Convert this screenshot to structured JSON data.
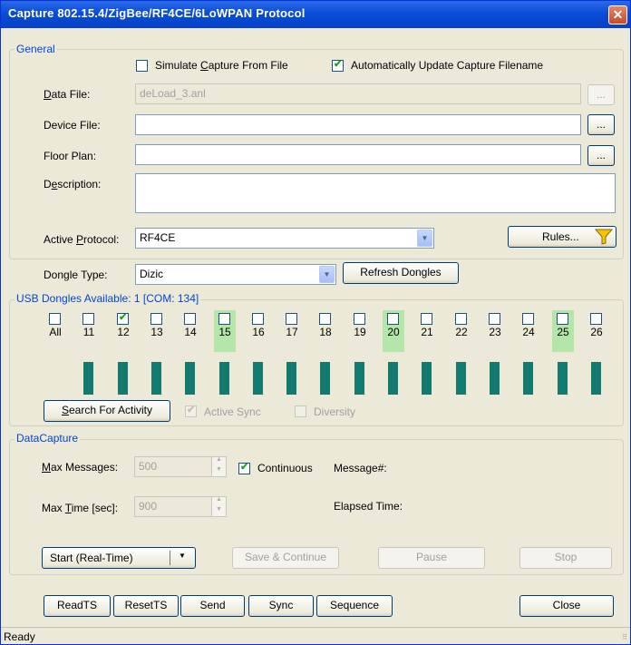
{
  "window": {
    "title": "Capture 802.15.4/ZigBee/RF4CE/6LoWPAN Protocol",
    "close_glyph": "✕"
  },
  "general": {
    "legend": "General",
    "simulate_label": "Simulate ",
    "simulate_u": "C",
    "simulate_rest": "apture From File",
    "simulate_checked": false,
    "auto_update_label": "Automatically Update Capture Filename",
    "auto_update_checked": true,
    "data_file_u": "D",
    "data_file_label": "ata File:",
    "data_file_value": "deLoad_3.anl",
    "device_file_label": "Device File:",
    "device_file_value": "",
    "floor_plan_label": "Floor Plan:",
    "floor_plan_value": "",
    "description_pre": "D",
    "description_u": "e",
    "description_rest": "scription:",
    "description_value": "",
    "browse_label": "...",
    "active_protocol_pre": "Active ",
    "active_protocol_u": "P",
    "active_protocol_rest": "rotocol:",
    "active_protocol_value": "RF4CE",
    "rules_label": "Rules...",
    "filter_icon": "funnel-icon"
  },
  "dongle": {
    "type_label": "Dongle Type:",
    "type_value": "Dizic",
    "refresh_label": "Refresh Dongles"
  },
  "usb": {
    "legend": "USB Dongles Available:  1 [COM: 134]",
    "channels": [
      {
        "label": "All",
        "checked": false,
        "highlight": false,
        "bar": false
      },
      {
        "label": "11",
        "checked": false,
        "highlight": false,
        "bar": true
      },
      {
        "label": "12",
        "checked": true,
        "highlight": false,
        "bar": true
      },
      {
        "label": "13",
        "checked": false,
        "highlight": false,
        "bar": true
      },
      {
        "label": "14",
        "checked": false,
        "highlight": false,
        "bar": true
      },
      {
        "label": "15",
        "checked": false,
        "highlight": true,
        "bar": true
      },
      {
        "label": "16",
        "checked": false,
        "highlight": false,
        "bar": true
      },
      {
        "label": "17",
        "checked": false,
        "highlight": false,
        "bar": true
      },
      {
        "label": "18",
        "checked": false,
        "highlight": false,
        "bar": true
      },
      {
        "label": "19",
        "checked": false,
        "highlight": false,
        "bar": true
      },
      {
        "label": "20",
        "checked": false,
        "highlight": true,
        "bar": true
      },
      {
        "label": "21",
        "checked": false,
        "highlight": false,
        "bar": true
      },
      {
        "label": "22",
        "checked": false,
        "highlight": false,
        "bar": true
      },
      {
        "label": "23",
        "checked": false,
        "highlight": false,
        "bar": true
      },
      {
        "label": "24",
        "checked": false,
        "highlight": false,
        "bar": true
      },
      {
        "label": "25",
        "checked": false,
        "highlight": true,
        "bar": true
      },
      {
        "label": "26",
        "checked": false,
        "highlight": false,
        "bar": true
      }
    ],
    "search_u": "S",
    "search_rest": "earch For Activity",
    "active_sync_label": "Active Sync",
    "active_sync_checked": true,
    "diversity_label": "Diversity",
    "diversity_checked": false
  },
  "datacapture": {
    "legend": "DataCapture",
    "max_messages_u": "M",
    "max_messages_rest": "ax Messages:",
    "max_messages_value": "500",
    "continuous_label": "Continuous",
    "continuous_checked": true,
    "message_num_label": "Message#:",
    "max_time_pre": "Max ",
    "max_time_u": "T",
    "max_time_rest": "ime [sec]:",
    "max_time_value": "900",
    "elapsed_label": "Elapsed Time:",
    "start_label": "Start (Real-Time)",
    "save_continue_label": "Save & Continue",
    "pause_label": "Pause",
    "stop_label": "Stop"
  },
  "bottom": {
    "readts_label": "ReadTS",
    "resetts_label": "ResetTS",
    "send_label": "Send",
    "sync_label": "Sync",
    "sequence_label": "Sequence",
    "close_label": "Close"
  },
  "status": {
    "text": "Ready"
  },
  "colors": {
    "title_bar": "#0a4dd6",
    "legend_text": "#0046d5",
    "channel_highlight": "#b5e6a9",
    "activity_bar": "#127a6e",
    "check": "#21a121"
  }
}
